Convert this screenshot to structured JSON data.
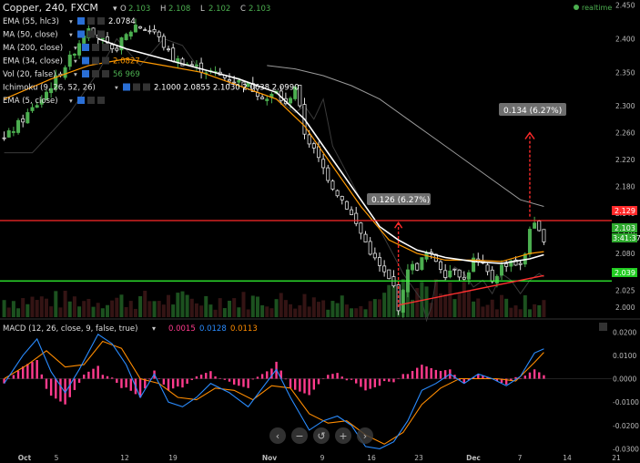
{
  "header": {
    "title": "Copper, 240, FXCM",
    "ohlc": [
      {
        "k": "O",
        "v": "2.103"
      },
      {
        "k": "H",
        "v": "2.108"
      },
      {
        "k": "L",
        "v": "2.102"
      },
      {
        "k": "C",
        "v": "2.103"
      }
    ],
    "realtime": "realtime"
  },
  "indicators": [
    {
      "label": "EMA (55, hlc3)",
      "value": "2.0784",
      "color": "#ffffff"
    },
    {
      "label": "MA (50, close)",
      "value": "",
      "color": "#ffffff"
    },
    {
      "label": "MA (200, close)",
      "value": "",
      "color": "#ffffff"
    },
    {
      "label": "EMA (34, close)",
      "value": "2.0827",
      "color": "#ff9900"
    },
    {
      "label": "Vol (20, false)",
      "value": "56  969",
      "color": "#4caf50"
    },
    {
      "label": "Ichimoku (9, 26, 52, 26)",
      "value": "2.1000  2.0855  2.1030  2.0638  2.0990",
      "color": "#ffffff"
    },
    {
      "label": "EMA (5, close)",
      "value": "",
      "color": "#ffffff"
    }
  ],
  "price_labels": {
    "red_line": "2.129",
    "current": "2.103",
    "countdown": "3:41:37",
    "green_line": "2.039"
  },
  "measure_labels": {
    "lower": "0.126 (6.27%)",
    "upper": "0.134 (6.27%)"
  },
  "macd_header": {
    "label": "MACD (12, 26, close, 9, false, true)",
    "values": [
      {
        "v": "0.0015",
        "color": "#ff3b8d"
      },
      {
        "v": "0.0128",
        "color": "#2a8cff"
      },
      {
        "v": "0.0113",
        "color": "#ff8c00"
      }
    ]
  },
  "nav_buttons": [
    {
      "name": "scroll-left-icon",
      "glyph": "‹"
    },
    {
      "name": "zoom-out-icon",
      "glyph": "−"
    },
    {
      "name": "reset-icon",
      "glyph": "↺"
    },
    {
      "name": "zoom-in-icon",
      "glyph": "+"
    },
    {
      "name": "scroll-right-icon",
      "glyph": "›"
    }
  ],
  "colors": {
    "up": "#4caf50",
    "down": "#e0e0e0",
    "red_line": "#ff2a2a",
    "green_line": "#33ff33",
    "ema34": "#ff9900",
    "ma50": "#ffffff",
    "ma200": "#9a9a9a",
    "macd": "#2a8cff",
    "signal": "#ff8c00",
    "hist": "#ff3b8d"
  },
  "chart_data": [
    {
      "type": "candlestick",
      "title": "Copper, 240, FXCM",
      "x_ticks": [
        "Oct",
        "5",
        "12",
        "19",
        "Nov",
        "9",
        "16",
        "23",
        "Dec",
        "7",
        "14",
        "21"
      ],
      "y_ticks": [
        "2.000",
        "2.025",
        "2.050",
        "2.080",
        "2.110",
        "2.140",
        "2.180",
        "2.220",
        "2.260",
        "2.300",
        "2.350",
        "2.400",
        "2.450"
      ],
      "ylim": [
        1.985,
        2.455
      ],
      "grid": false,
      "close_path": [
        [
          0,
          2.25
        ],
        [
          8,
          2.31
        ],
        [
          14,
          2.37
        ],
        [
          18,
          2.42
        ],
        [
          23,
          2.38
        ],
        [
          28,
          2.42
        ],
        [
          32,
          2.41
        ],
        [
          36,
          2.37
        ],
        [
          40,
          2.36
        ],
        [
          44,
          2.35
        ],
        [
          48,
          2.34
        ],
        [
          52,
          2.33
        ],
        [
          56,
          2.31
        ],
        [
          58,
          2.32
        ],
        [
          60,
          2.3
        ],
        [
          62,
          2.33
        ],
        [
          64,
          2.26
        ],
        [
          67,
          2.22
        ],
        [
          70,
          2.18
        ],
        [
          73,
          2.15
        ],
        [
          76,
          2.11
        ],
        [
          79,
          2.07
        ],
        [
          81,
          2.05
        ],
        [
          82,
          2.04
        ],
        [
          83,
          2.03
        ],
        [
          84,
          2.0
        ],
        [
          85,
          2.02
        ],
        [
          86,
          2.06
        ],
        [
          88,
          2.06
        ],
        [
          90,
          2.08
        ],
        [
          92,
          2.07
        ],
        [
          94,
          2.05
        ],
        [
          96,
          2.06
        ],
        [
          98,
          2.04
        ],
        [
          100,
          2.07
        ],
        [
          102,
          2.06
        ],
        [
          104,
          2.04
        ],
        [
          106,
          2.06
        ],
        [
          108,
          2.07
        ],
        [
          110,
          2.06
        ],
        [
          111,
          2.08
        ],
        [
          112,
          2.12
        ],
        [
          113,
          2.12
        ],
        [
          114,
          2.11
        ],
        [
          115,
          2.103
        ]
      ],
      "ema34": [
        [
          0,
          2.31
        ],
        [
          10,
          2.34
        ],
        [
          18,
          2.36
        ],
        [
          26,
          2.37
        ],
        [
          34,
          2.36
        ],
        [
          42,
          2.35
        ],
        [
          50,
          2.33
        ],
        [
          58,
          2.31
        ],
        [
          64,
          2.27
        ],
        [
          70,
          2.21
        ],
        [
          76,
          2.15
        ],
        [
          82,
          2.1
        ],
        [
          88,
          2.08
        ],
        [
          94,
          2.07
        ],
        [
          100,
          2.07
        ],
        [
          106,
          2.068
        ],
        [
          112,
          2.08
        ],
        [
          115,
          2.0827
        ]
      ],
      "ma50": [
        [
          20,
          2.4
        ],
        [
          26,
          2.385
        ],
        [
          34,
          2.37
        ],
        [
          42,
          2.355
        ],
        [
          50,
          2.34
        ],
        [
          58,
          2.32
        ],
        [
          64,
          2.28
        ],
        [
          70,
          2.22
        ],
        [
          76,
          2.16
        ],
        [
          80,
          2.12
        ],
        [
          84,
          2.1
        ],
        [
          88,
          2.085
        ],
        [
          94,
          2.074
        ],
        [
          100,
          2.068
        ],
        [
          106,
          2.065
        ],
        [
          112,
          2.072
        ],
        [
          115,
          2.078
        ]
      ],
      "ma200": [
        [
          56,
          2.36
        ],
        [
          62,
          2.355
        ],
        [
          68,
          2.345
        ],
        [
          74,
          2.33
        ],
        [
          80,
          2.31
        ],
        [
          86,
          2.28
        ],
        [
          92,
          2.25
        ],
        [
          98,
          2.22
        ],
        [
          104,
          2.19
        ],
        [
          110,
          2.16
        ],
        [
          115,
          2.15
        ]
      ],
      "horizontal_lines": [
        2.129,
        2.039
      ],
      "support_trendline": [
        [
          84,
          2.003
        ],
        [
          115,
          2.047
        ]
      ],
      "measure": {
        "from": [
          84,
          2.0
        ],
        "to": [
          84,
          2.126
        ],
        "target_from": [
          112,
          2.135
        ],
        "target_to": [
          112,
          2.26
        ]
      }
    },
    {
      "type": "macd",
      "title": "MACD (12, 26, close, 9, false, true)",
      "y_ticks": [
        "0.0200",
        "0.0100",
        "0.0000",
        "-0.0100",
        "-0.0200",
        "-0.0300"
      ],
      "ylim": [
        -0.031,
        0.024
      ],
      "macd": [
        [
          0,
          -0.002
        ],
        [
          4,
          0.01
        ],
        [
          7,
          0.017
        ],
        [
          10,
          0.003
        ],
        [
          13,
          -0.006
        ],
        [
          16,
          0.004
        ],
        [
          20,
          0.019
        ],
        [
          23,
          0.015
        ],
        [
          26,
          0.006
        ],
        [
          29,
          -0.008
        ],
        [
          32,
          0.002
        ],
        [
          35,
          -0.01
        ],
        [
          38,
          -0.012
        ],
        [
          41,
          -0.008
        ],
        [
          44,
          -0.002
        ],
        [
          48,
          -0.006
        ],
        [
          52,
          -0.012
        ],
        [
          55,
          -0.004
        ],
        [
          58,
          0.004
        ],
        [
          61,
          -0.008
        ],
        [
          65,
          -0.022
        ],
        [
          68,
          -0.018
        ],
        [
          71,
          -0.016
        ],
        [
          74,
          -0.02
        ],
        [
          77,
          -0.029
        ],
        [
          80,
          -0.03
        ],
        [
          83,
          -0.027
        ],
        [
          86,
          -0.018
        ],
        [
          89,
          -0.005
        ],
        [
          92,
          -0.002
        ],
        [
          95,
          0.002
        ],
        [
          98,
          -0.002
        ],
        [
          101,
          0.002
        ],
        [
          104,
          0.0
        ],
        [
          107,
          -0.003
        ],
        [
          110,
          0.001
        ],
        [
          113,
          0.011
        ],
        [
          115,
          0.0128
        ]
      ],
      "signal": [
        [
          0,
          0.0
        ],
        [
          5,
          0.006
        ],
        [
          9,
          0.012
        ],
        [
          13,
          0.005
        ],
        [
          17,
          0.006
        ],
        [
          21,
          0.016
        ],
        [
          25,
          0.013
        ],
        [
          29,
          0.0
        ],
        [
          33,
          -0.002
        ],
        [
          37,
          -0.008
        ],
        [
          41,
          -0.009
        ],
        [
          45,
          -0.004
        ],
        [
          49,
          -0.005
        ],
        [
          53,
          -0.009
        ],
        [
          57,
          -0.003
        ],
        [
          61,
          -0.004
        ],
        [
          65,
          -0.015
        ],
        [
          69,
          -0.019
        ],
        [
          73,
          -0.018
        ],
        [
          77,
          -0.024
        ],
        [
          81,
          -0.028
        ],
        [
          85,
          -0.023
        ],
        [
          89,
          -0.011
        ],
        [
          93,
          -0.004
        ],
        [
          97,
          0.0
        ],
        [
          101,
          0.0
        ],
        [
          105,
          0.0
        ],
        [
          109,
          -0.001
        ],
        [
          113,
          0.007
        ],
        [
          115,
          0.0113
        ]
      ]
    }
  ]
}
